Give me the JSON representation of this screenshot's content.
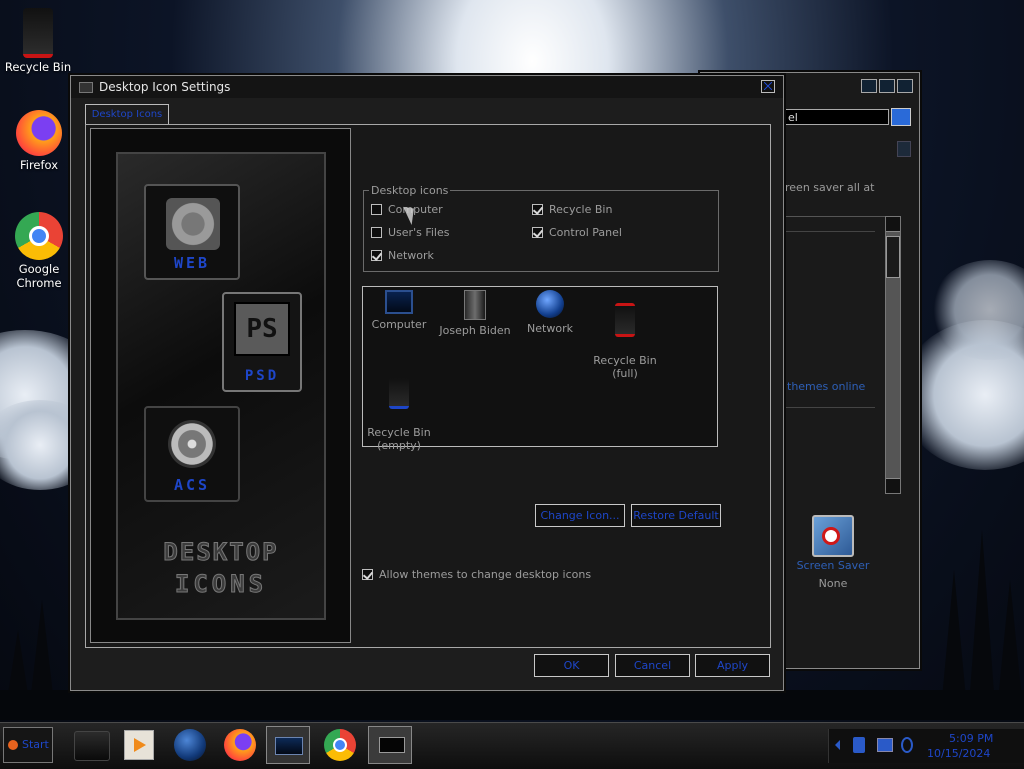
{
  "desktop": {
    "icons": [
      {
        "label": "Recycle Bin"
      },
      {
        "label": "Firefox"
      },
      {
        "label": "Google Chrome"
      }
    ]
  },
  "back_window": {
    "search_value": "el",
    "text_snippet": "reen saver all at",
    "link_text": "themes online",
    "screen_saver_label": "Screen Saver",
    "screen_saver_value": "None"
  },
  "dialog": {
    "title": "Desktop Icon Settings",
    "tab_label": "Desktop Icons",
    "art": {
      "tile1": "WEB",
      "tile2_big": "PS",
      "tile2": "PSD",
      "tile3": "ACS",
      "banner_line1": "DESKTOP",
      "banner_line2": "ICONS"
    },
    "group_title": "Desktop icons",
    "checkboxes": [
      {
        "label": "Computer",
        "checked": false
      },
      {
        "label": "User's Files",
        "checked": false
      },
      {
        "label": "Network",
        "checked": true
      },
      {
        "label": "Recycle Bin",
        "checked": true
      },
      {
        "label": "Control Panel",
        "checked": true
      }
    ],
    "icons": [
      {
        "label": "Computer",
        "icon": "monitor-icon"
      },
      {
        "label": "Joseph Biden",
        "icon": "user-files-icon"
      },
      {
        "label": "Network",
        "icon": "globe-icon"
      },
      {
        "label": "Recycle Bin\n(full)",
        "icon": "recycle-bin-full-icon"
      },
      {
        "label": "Recycle Bin\n(empty)",
        "icon": "recycle-bin-empty-icon"
      }
    ],
    "change_icon": "Change Icon...",
    "restore_default": "Restore Default",
    "allow_themes": "Allow themes to change desktop icons",
    "allow_themes_checked": true,
    "ok": "OK",
    "cancel": "Cancel",
    "apply": "Apply"
  },
  "taskbar": {
    "start": "Start",
    "time": "5:09 PM",
    "date": "10/15/2024"
  },
  "colors": {
    "accent": "#1e46c8",
    "panel": "#1c1c1c",
    "border": "#bdbdbd"
  }
}
